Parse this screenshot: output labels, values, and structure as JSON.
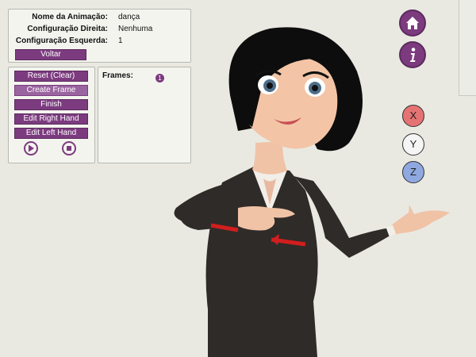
{
  "animation": {
    "name_label": "Nome da Animação:",
    "name_value": "dança",
    "right_config_label": "Configuração Direita:",
    "right_config_value": "Nenhuma",
    "left_config_label": "Configuração Esquerda:",
    "left_config_value": "1",
    "back_button": "Voltar"
  },
  "controls": {
    "reset": "Reset (Clear)",
    "create_frame": "Create Frame",
    "finish": "Finish",
    "edit_right": "Edit Right Hand",
    "edit_left": "Edit Left Hand",
    "play_icon": "play-icon",
    "stop_icon": "stop-icon"
  },
  "frames": {
    "title": "Frames:",
    "items": [
      "1"
    ]
  },
  "right_toolbar": {
    "home_icon": "home-icon",
    "info_icon": "info-icon",
    "axes": [
      "X",
      "Y",
      "Z"
    ]
  },
  "colors": {
    "accent": "#7c3b7f",
    "axis_x": "#e57373",
    "axis_y": "#f5f5f5",
    "axis_z": "#8fa8e0"
  }
}
